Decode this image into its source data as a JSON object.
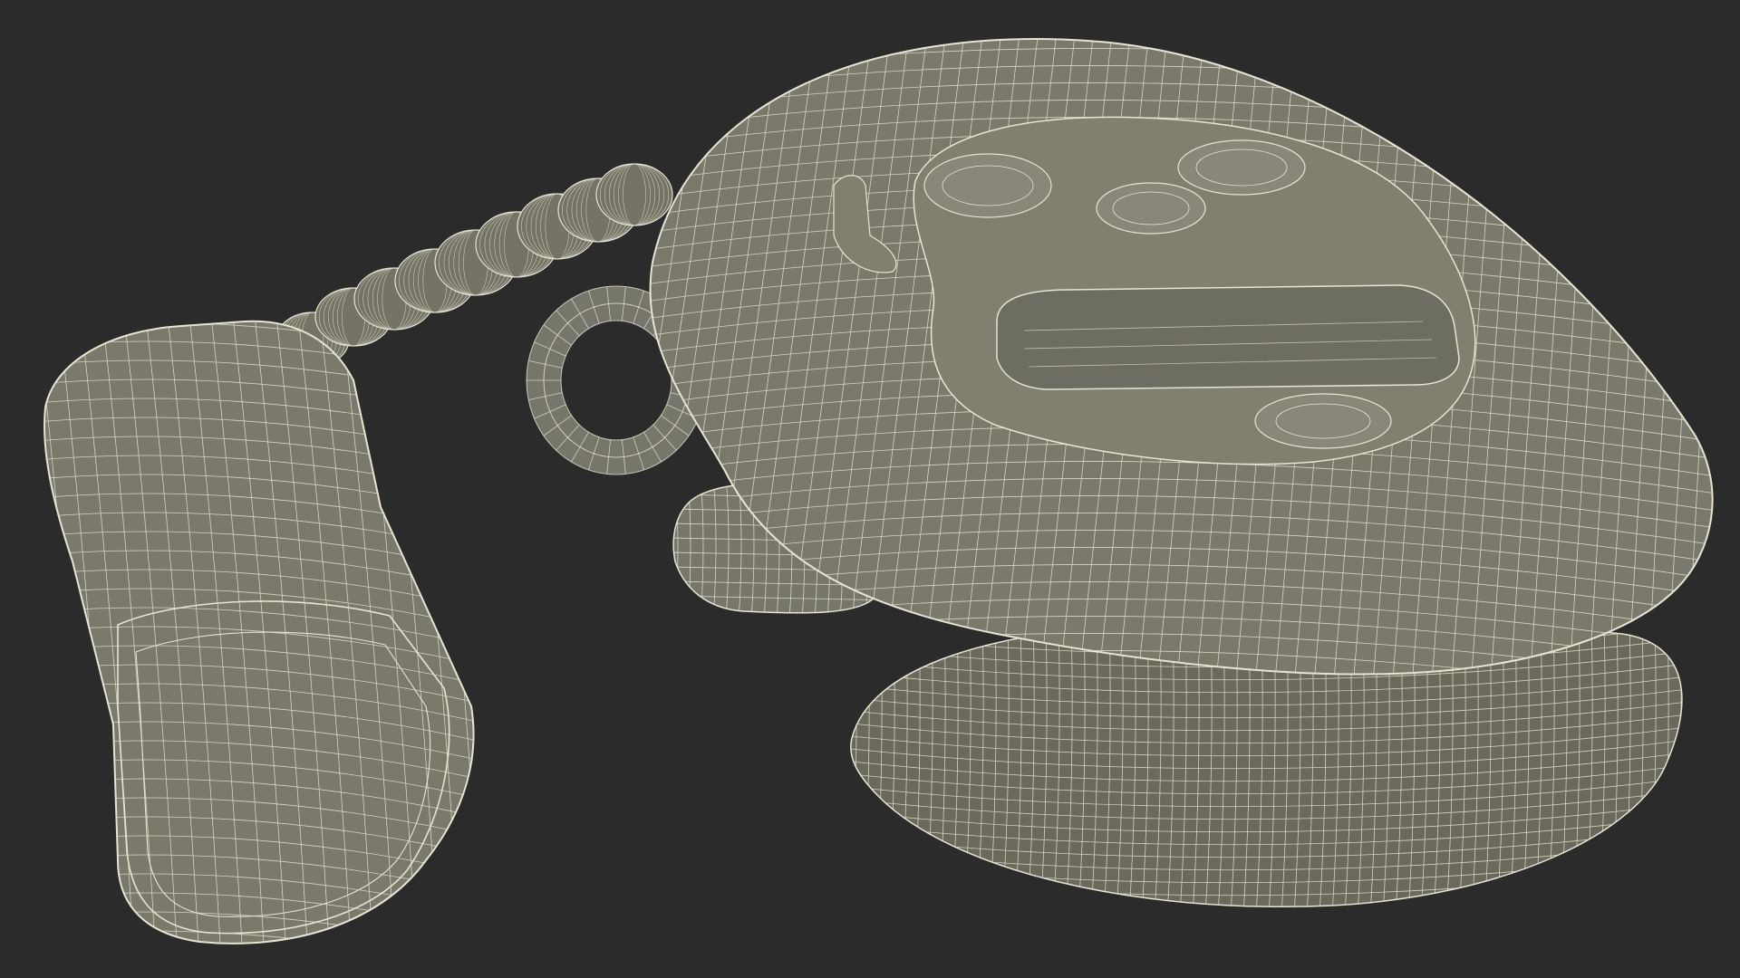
{
  "scene": {
    "background": "#2b2b2b",
    "surface_color": "#7c7b6c",
    "surface_dark": "#5c5b50",
    "surface_light": "#8e8d7e",
    "wire_color": "#e6e4d2",
    "subject": "wireframe-mesh-render"
  }
}
